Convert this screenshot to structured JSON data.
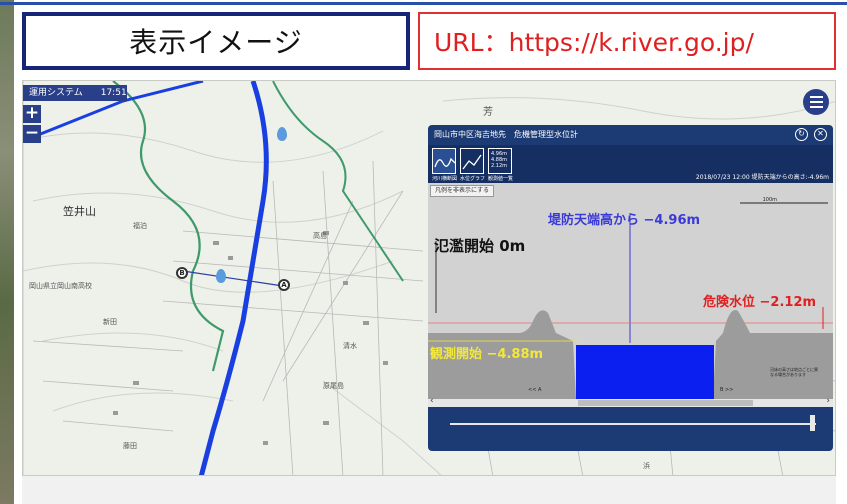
{
  "slide": {
    "title": "表示イメージ",
    "url_text": "URL：https://k.river.go.jp/"
  },
  "map": {
    "app_name": "運用システム　　17:51",
    "zoom_in": "+",
    "zoom_out": "−",
    "mountain_label": "笠井山",
    "marker_a": "A",
    "marker_b": "B",
    "place_labels": [
      "岡山県立岡山南高校",
      "福泊",
      "新田",
      "高島",
      "清水",
      "原尾島",
      "藤田",
      "浜",
      "芳"
    ]
  },
  "panel": {
    "header_title": "岡山市中区海吉地先　危機管理型水位計",
    "tabs": [
      "河川横断図",
      "水位グラフ",
      "観測値一覧"
    ],
    "tab_readout": [
      "4.96m",
      "4.88m",
      "2.12m"
    ],
    "timestamp": "2018/07/23 12:00  堤防天端からの高さ:-4.96m",
    "legend_toggle": "凡例を非表示にする",
    "scale_label": "100m",
    "levee_label": "堤防天端高から",
    "levee_value": " −4.96m",
    "flood_label": "氾濫開始 0m",
    "danger_label": "危険水位",
    "danger_value": " −2.12m",
    "observe_label": "観測開始",
    "observe_value": " −4.88m",
    "note": "河床の高さは地点ごとに異なる場合があります",
    "left_bank": "<< A",
    "right_bank": "B >>",
    "scroll_left": "‹",
    "scroll_right": "›"
  },
  "colors": {
    "navy": "#14257a",
    "red": "#e02020",
    "panel_blue": "#1c3a74",
    "water": "#0b20f0",
    "levee_text": "#3a3ad8",
    "danger_text": "#e02020",
    "observe_text": "#f3e83a"
  }
}
